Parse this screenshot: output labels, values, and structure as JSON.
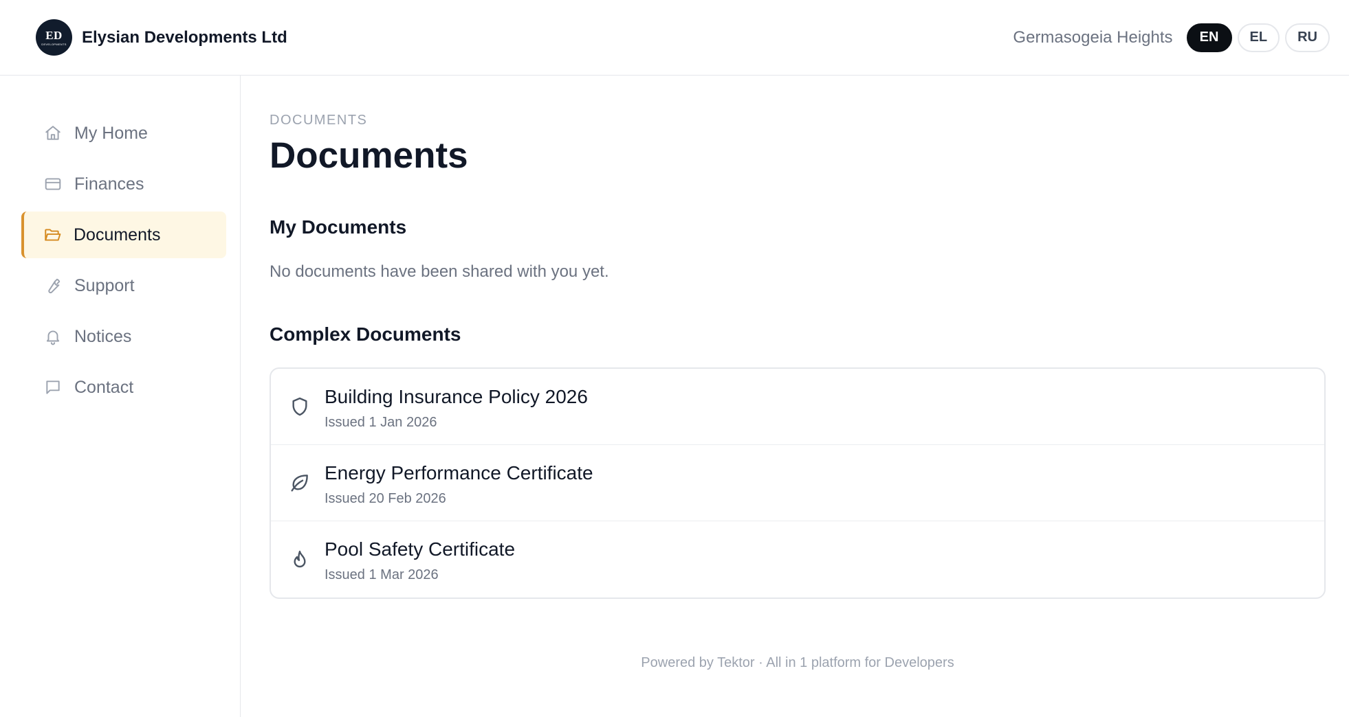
{
  "header": {
    "logo_monogram": "ED",
    "logo_subtext": "DEVELOPMENTS",
    "company_name": "Elysian Developments Ltd",
    "project_name": "Germasogeia Heights",
    "languages": [
      "EN",
      "EL",
      "RU"
    ],
    "active_language": "EN"
  },
  "sidebar": {
    "items": [
      {
        "label": "My Home",
        "icon": "home-icon"
      },
      {
        "label": "Finances",
        "icon": "credit-card-icon"
      },
      {
        "label": "Documents",
        "icon": "folder-open-icon",
        "active": true
      },
      {
        "label": "Support",
        "icon": "wrench-icon"
      },
      {
        "label": "Notices",
        "icon": "bell-icon"
      },
      {
        "label": "Contact",
        "icon": "message-square-icon"
      }
    ]
  },
  "main": {
    "eyebrow": "DOCUMENTS",
    "title": "Documents",
    "my_documents": {
      "heading": "My Documents",
      "empty_text": "No documents have been shared with you yet."
    },
    "complex_documents": {
      "heading": "Complex Documents",
      "items": [
        {
          "title": "Building Insurance Policy 2026",
          "date": "Issued 1 Jan 2026",
          "icon": "shield-icon"
        },
        {
          "title": "Energy Performance Certificate",
          "date": "Issued 20 Feb 2026",
          "icon": "leaf-icon"
        },
        {
          "title": "Pool Safety Certificate",
          "date": "Issued 1 Mar 2026",
          "icon": "flame-icon"
        }
      ]
    },
    "footer": "Powered by Tektor · All in 1 platform for Developers"
  },
  "colors": {
    "accent": "#d9922e",
    "active_bg": "#fef7e4",
    "logo_bg": "#111c2c",
    "active_lang_bg": "#0b0f14"
  }
}
